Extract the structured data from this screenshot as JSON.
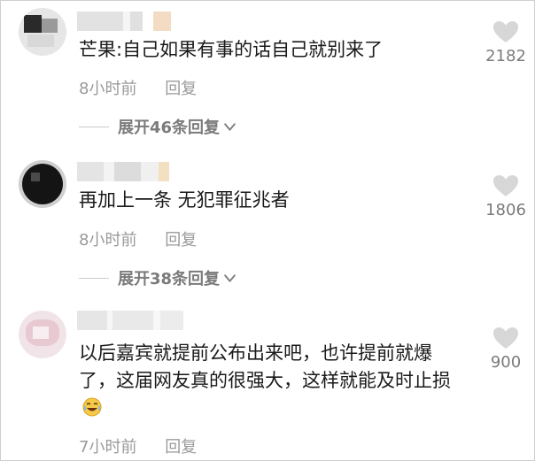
{
  "comments": [
    {
      "text": "芒果:自己如果有事的话自己就别来了",
      "time": "8小时前",
      "reply_label": "回复",
      "likes": "2182",
      "expand_label": "展开46条回复"
    },
    {
      "text": "再加上一条 无犯罪征兆者",
      "time": "8小时前",
      "reply_label": "回复",
      "likes": "1806",
      "expand_label": "展开38条回复"
    },
    {
      "text": "以后嘉宾就提前公布出来吧，也许提前就爆了，这届网友真的很强大，这样就能及时止损",
      "time": "7小时前",
      "reply_label": "回复",
      "likes": "900"
    }
  ],
  "icons": {
    "like": "heart-icon",
    "expand": "chevron-down-icon",
    "emoji": "laugh-cry-emoji-icon"
  },
  "colors": {
    "like_icon": "#d7d7d7",
    "meta_text": "#9a9a9a",
    "expand_text": "#7b7b7b"
  }
}
